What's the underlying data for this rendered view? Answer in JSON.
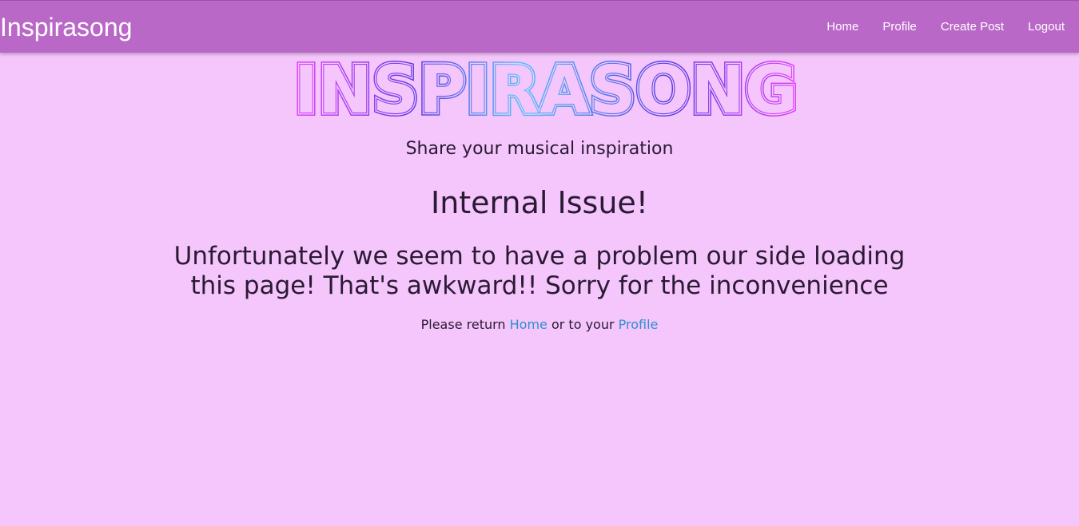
{
  "navbar": {
    "brand": "Inspirasong",
    "links": [
      "Home",
      "Profile",
      "Create Post",
      "Logout"
    ]
  },
  "hero": {
    "logo_text": "INSPIRASONG",
    "tagline": "Share your musical inspiration"
  },
  "error": {
    "title": "Internal Issue!",
    "message": "Unfortunately we seem to have a problem our side loading this page! That's awkward!! Sorry for the inconvenience",
    "return_prefix": "Please return ",
    "return_home_link": "Home",
    "return_middle": " or to your ",
    "return_profile_link": "Profile"
  },
  "colors": {
    "page_background": "#f5c6fc",
    "navbar_background": "#ba68c8",
    "link_color": "#2f8fd0",
    "logo_gradient": [
      "#e040fb",
      "#5b3ce0",
      "#4fc3f7",
      "#5b3ce0",
      "#e040fb"
    ]
  }
}
